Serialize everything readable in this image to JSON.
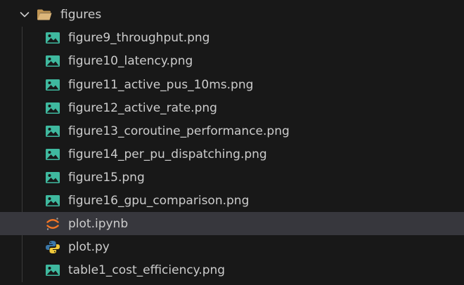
{
  "folder": {
    "name": "figures",
    "expanded": true,
    "icon": "folder-open-icon"
  },
  "files": [
    {
      "label": "figure9_throughput.png",
      "icon": "image-icon",
      "selected": false
    },
    {
      "label": "figure10_latency.png",
      "icon": "image-icon",
      "selected": false
    },
    {
      "label": "figure11_active_pus_10ms.png",
      "icon": "image-icon",
      "selected": false
    },
    {
      "label": "figure12_active_rate.png",
      "icon": "image-icon",
      "selected": false
    },
    {
      "label": "figure13_coroutine_performance.png",
      "icon": "image-icon",
      "selected": false
    },
    {
      "label": "figure14_per_pu_dispatching.png",
      "icon": "image-icon",
      "selected": false
    },
    {
      "label": "figure15.png",
      "icon": "image-icon",
      "selected": false
    },
    {
      "label": "figure16_gpu_comparison.png",
      "icon": "image-icon",
      "selected": false
    },
    {
      "label": "plot.ipynb",
      "icon": "jupyter-icon",
      "selected": true
    },
    {
      "label": "plot.py",
      "icon": "python-icon",
      "selected": false
    },
    {
      "label": "table1_cost_efficiency.png",
      "icon": "image-icon",
      "selected": false
    }
  ],
  "colors": {
    "background": "#181818",
    "selection": "#37373d",
    "text": "#cccccc",
    "image_icon": "#3fb99f",
    "folder_icon": "#c09553",
    "jupyter_icon": "#f37626",
    "python_blue": "#3b77a8",
    "python_yellow": "#f0c93a"
  }
}
